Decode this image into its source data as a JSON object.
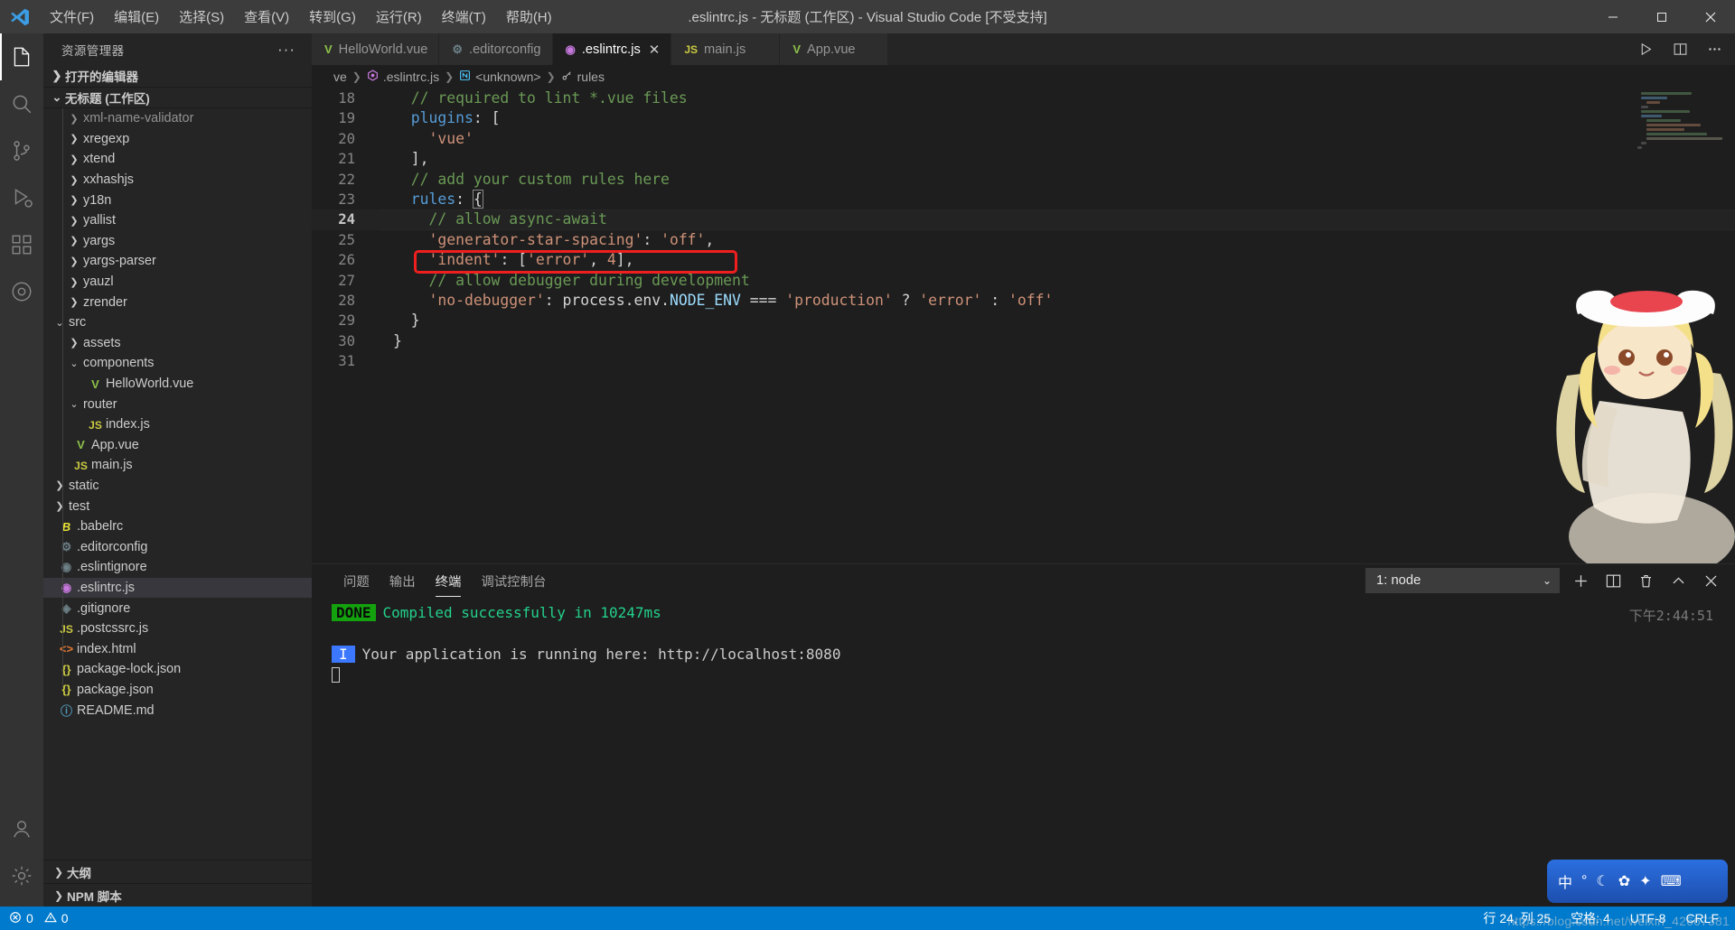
{
  "window": {
    "title": ".eslintrc.js - 无标题 (工作区) - Visual Studio Code [不受支持]",
    "minimize": "−",
    "maximize": "▢",
    "close": "✕"
  },
  "menubar": [
    {
      "label": "文件(F)"
    },
    {
      "label": "编辑(E)"
    },
    {
      "label": "选择(S)"
    },
    {
      "label": "查看(V)"
    },
    {
      "label": "转到(G)"
    },
    {
      "label": "运行(R)"
    },
    {
      "label": "终端(T)"
    },
    {
      "label": "帮助(H)"
    }
  ],
  "activitybar": [
    {
      "name": "explorer-icon",
      "active": true
    },
    {
      "name": "search-icon",
      "active": false
    },
    {
      "name": "source-control-icon",
      "active": false
    },
    {
      "name": "run-debug-icon",
      "active": false
    },
    {
      "name": "extensions-icon",
      "active": false
    },
    {
      "name": "test-beaker-icon",
      "active": false
    },
    {
      "name": "account-icon",
      "active": false
    },
    {
      "name": "settings-gear-icon",
      "active": false
    }
  ],
  "sidebar": {
    "title": "资源管理器",
    "more_actions": "···",
    "sections": {
      "open_editors": "打开的编辑器",
      "workspace": "无标题 (工作区)",
      "outline": "大纲",
      "npm_scripts": "NPM 脚本"
    },
    "tree": [
      {
        "label": "xml-name-validator",
        "kind": "folder",
        "depth": 1,
        "expanded": false,
        "clipped": true
      },
      {
        "label": "xregexp",
        "kind": "folder",
        "depth": 1,
        "expanded": false
      },
      {
        "label": "xtend",
        "kind": "folder",
        "depth": 1,
        "expanded": false
      },
      {
        "label": "xxhashjs",
        "kind": "folder",
        "depth": 1,
        "expanded": false
      },
      {
        "label": "y18n",
        "kind": "folder",
        "depth": 1,
        "expanded": false
      },
      {
        "label": "yallist",
        "kind": "folder",
        "depth": 1,
        "expanded": false
      },
      {
        "label": "yargs",
        "kind": "folder",
        "depth": 1,
        "expanded": false
      },
      {
        "label": "yargs-parser",
        "kind": "folder",
        "depth": 1,
        "expanded": false
      },
      {
        "label": "yauzl",
        "kind": "folder",
        "depth": 1,
        "expanded": false
      },
      {
        "label": "zrender",
        "kind": "folder",
        "depth": 1,
        "expanded": false
      },
      {
        "label": "src",
        "kind": "folder",
        "depth": 0,
        "expanded": true
      },
      {
        "label": "assets",
        "kind": "folder",
        "depth": 1,
        "expanded": false
      },
      {
        "label": "components",
        "kind": "folder",
        "depth": 1,
        "expanded": true
      },
      {
        "label": "HelloWorld.vue",
        "kind": "vue",
        "depth": 2
      },
      {
        "label": "router",
        "kind": "folder",
        "depth": 1,
        "expanded": true
      },
      {
        "label": "index.js",
        "kind": "js",
        "depth": 2
      },
      {
        "label": "App.vue",
        "kind": "vue",
        "depth": 1
      },
      {
        "label": "main.js",
        "kind": "js",
        "depth": 1
      },
      {
        "label": "static",
        "kind": "folder",
        "depth": 0,
        "expanded": false
      },
      {
        "label": "test",
        "kind": "folder",
        "depth": 0,
        "expanded": false
      },
      {
        "label": ".babelrc",
        "kind": "babel",
        "depth": 0
      },
      {
        "label": ".editorconfig",
        "kind": "gear",
        "depth": 0
      },
      {
        "label": ".eslintignore",
        "kind": "eslint-gray",
        "depth": 0
      },
      {
        "label": ".eslintrc.js",
        "kind": "eslint",
        "depth": 0,
        "selected": true
      },
      {
        "label": ".gitignore",
        "kind": "git",
        "depth": 0
      },
      {
        "label": ".postcssrc.js",
        "kind": "js",
        "depth": 0
      },
      {
        "label": "index.html",
        "kind": "html",
        "depth": 0
      },
      {
        "label": "package-lock.json",
        "kind": "json",
        "depth": 0
      },
      {
        "label": "package.json",
        "kind": "json",
        "depth": 0
      },
      {
        "label": "README.md",
        "kind": "md",
        "depth": 0
      }
    ]
  },
  "editor": {
    "tabs": [
      {
        "label": "HelloWorld.vue",
        "kind": "vue",
        "active": false,
        "closable": false
      },
      {
        "label": ".editorconfig",
        "kind": "gear",
        "active": false,
        "closable": false
      },
      {
        "label": ".eslintrc.js",
        "kind": "eslint",
        "active": true,
        "closable": true,
        "close": "✕"
      },
      {
        "label": "main.js",
        "kind": "js",
        "active": false,
        "closable": false
      },
      {
        "label": "App.vue",
        "kind": "vue",
        "active": false,
        "closable": false
      }
    ],
    "breadcrumbs": [
      {
        "label": "ve",
        "icon": ""
      },
      {
        "label": ".eslintrc.js",
        "icon": "eslint"
      },
      {
        "label": "<unknown>",
        "icon": "namespace"
      },
      {
        "label": "rules",
        "icon": "key"
      }
    ],
    "lines": [
      {
        "num": "18",
        "indent": 2,
        "tokens": [
          {
            "t": "// required to lint *.vue files",
            "c": "com"
          }
        ]
      },
      {
        "num": "19",
        "indent": 2,
        "tokens": [
          {
            "t": "plugins",
            "c": "prop-key"
          },
          {
            "t": ": [",
            "c": "pl"
          }
        ]
      },
      {
        "num": "20",
        "indent": 4,
        "tokens": [
          {
            "t": "'vue'",
            "c": "str"
          }
        ]
      },
      {
        "num": "21",
        "indent": 2,
        "tokens": [
          {
            "t": "],",
            "c": "pl"
          }
        ]
      },
      {
        "num": "22",
        "indent": 2,
        "tokens": [
          {
            "t": "// add your custom rules here",
            "c": "com"
          }
        ]
      },
      {
        "num": "23",
        "indent": 2,
        "tokens": [
          {
            "t": "rules",
            "c": "prop-key"
          },
          {
            "t": ": ",
            "c": "pl"
          },
          {
            "t": "{",
            "c": "brace"
          }
        ]
      },
      {
        "num": "24",
        "indent": 4,
        "active": true,
        "tokens": [
          {
            "t": "// allow async-await",
            "c": "com"
          }
        ]
      },
      {
        "num": "25",
        "indent": 4,
        "tokens": [
          {
            "t": "'generator-star-spacing'",
            "c": "str"
          },
          {
            "t": ": ",
            "c": "pl"
          },
          {
            "t": "'off'",
            "c": "str"
          },
          {
            "t": ",",
            "c": "pl"
          }
        ]
      },
      {
        "num": "26",
        "indent": 4,
        "boxed": true,
        "tokens": [
          {
            "t": "'indent'",
            "c": "str"
          },
          {
            "t": ": [",
            "c": "pl"
          },
          {
            "t": "'error'",
            "c": "str"
          },
          {
            "t": ", ",
            "c": "pl"
          },
          {
            "t": "4",
            "c": "num"
          },
          {
            "t": "],",
            "c": "pl"
          }
        ]
      },
      {
        "num": "27",
        "indent": 4,
        "tokens": [
          {
            "t": "// allow debugger during development",
            "c": "com"
          }
        ]
      },
      {
        "num": "28",
        "indent": 4,
        "tokens": [
          {
            "t": "'no-debugger'",
            "c": "str"
          },
          {
            "t": ": ",
            "c": "pl"
          },
          {
            "t": "process",
            "c": "pl"
          },
          {
            "t": ".",
            "c": "pl"
          },
          {
            "t": "env",
            "c": "pl"
          },
          {
            "t": ".",
            "c": "pl"
          },
          {
            "t": "NODE_ENV",
            "c": "prop"
          },
          {
            "t": " === ",
            "c": "pl"
          },
          {
            "t": "'production'",
            "c": "str"
          },
          {
            "t": " ? ",
            "c": "pl"
          },
          {
            "t": "'error'",
            "c": "str"
          },
          {
            "t": " : ",
            "c": "pl"
          },
          {
            "t": "'off'",
            "c": "str"
          }
        ]
      },
      {
        "num": "29",
        "indent": 2,
        "tokens": [
          {
            "t": "}",
            "c": "pl"
          }
        ]
      },
      {
        "num": "30",
        "indent": 0,
        "tokens": [
          {
            "t": "}",
            "c": "pl"
          }
        ]
      },
      {
        "num": "31",
        "indent": 0,
        "tokens": []
      }
    ]
  },
  "panel": {
    "tabs": [
      {
        "label": "问题",
        "active": false
      },
      {
        "label": "输出",
        "active": false
      },
      {
        "label": "终端",
        "active": true
      },
      {
        "label": "调试控制台",
        "active": false
      }
    ],
    "terminal_select": "1: node",
    "chevron": "⌄",
    "actions": [
      "new-terminal",
      "split-terminal",
      "kill-terminal",
      "maximize-panel",
      "close-panel"
    ],
    "clock": "下午2:44:51",
    "output": [
      {
        "badge": "DONE",
        "badge_color": "#13a10e",
        "text": "Compiled successfully in 10247ms",
        "text_color": "#23d18b"
      },
      {
        "badge": "",
        "text": "",
        "text_color": "#cccccc"
      },
      {
        "badge": "I",
        "badge_color": "#3b78ff",
        "text": "Your application is running here: http://localhost:8080",
        "text_color": "#cccccc"
      }
    ]
  },
  "statusbar": {
    "errors": "0",
    "warnings": "0",
    "position": "行 24, 列 25",
    "spaces": "空格: 4",
    "encoding": "UTF-8",
    "eol": "CRLF"
  },
  "ime": {
    "lang": "中",
    "items": [
      "中",
      "°",
      "☾",
      "✿",
      "✦",
      "⌨"
    ]
  },
  "watermark": "https://blog.csdn.net/weixin_42667381",
  "colors": {
    "accent": "#007acc",
    "titlebar": "#3c3c3c",
    "sidebar": "#252526",
    "editor": "#1e1e1e",
    "annotation": "#f01f1f",
    "done_badge": "#13a10e"
  }
}
